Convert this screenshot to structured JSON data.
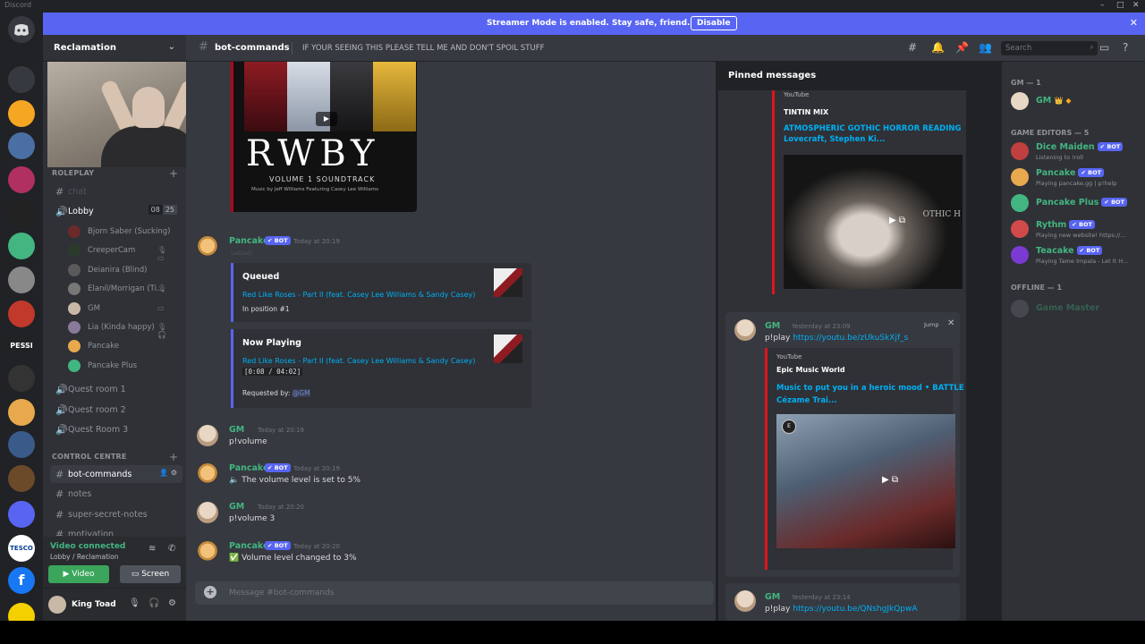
{
  "window": {
    "title": "Discord",
    "controls": [
      "–",
      "□",
      "✕"
    ]
  },
  "banner": {
    "text": "Streamer Mode is enabled. Stay safe, friend.",
    "button": "Disable",
    "close": "✕"
  },
  "guild": {
    "name": "Reclamation",
    "chevron": "⌄"
  },
  "sidebar": {
    "cat_roleplay": "ROLEPLAY",
    "plus": "+",
    "hidden_channel": "chat",
    "lobby": {
      "label": "Lobby",
      "count_a": "08",
      "count_b": "25"
    },
    "voice_users": [
      {
        "name": "Bjorn Saber (Sucking)",
        "color": "#6b2a2a",
        "icons": ""
      },
      {
        "name": "CreeperCam",
        "color": "#2b3a2b",
        "icons": "🎙 ▭"
      },
      {
        "name": "Deianira (Blind)",
        "color": "#5a5a5a",
        "icons": ""
      },
      {
        "name": "Elanil/Morrigan (Ti...",
        "color": "#777",
        "icons": "🎙"
      },
      {
        "name": "GM",
        "color": "#c8b8a6",
        "icons": "▭"
      },
      {
        "name": "Lia (Kinda happy)",
        "color": "#8a7a9a",
        "icons": "🎙 🎧"
      },
      {
        "name": "Pancake",
        "color": "#e8a94e",
        "icons": ""
      },
      {
        "name": "Pancake Plus",
        "color": "#43b581",
        "icons": ""
      }
    ],
    "quest_channels": [
      "Quest room 1",
      "Quest room 2",
      "Quest Room 3"
    ],
    "cat_control": "CONTROL CENTRE",
    "text_channels": [
      "bot-commands",
      "notes",
      "super-secret-notes",
      "motivation"
    ],
    "voice": {
      "status": "Video connected",
      "location": "Lobby / Reclamation",
      "video_btn": "Video",
      "screen_btn": "Screen"
    },
    "user": {
      "name": "King Toad"
    }
  },
  "header": {
    "channel": "bot-commands",
    "topic": "IF YOUR SEEING THIS PLEASE TELL ME AND DON'T SPOIL STUFF",
    "search_placeholder": "Search"
  },
  "rwby": {
    "logo": "RWBY",
    "subtitle": "VOLUME 1 SOUNDTRACK",
    "credits": "Music by Jeff Williams  Featuring Casey Lee Williams"
  },
  "chat": {
    "messages": [
      {
        "author": "Pancake",
        "bot": "✔ BOT",
        "time": "Today at 20:19"
      },
      {
        "author": "GM",
        "time": "Today at 20:19",
        "text": "p!volume"
      },
      {
        "author": "Pancake",
        "bot": "✔ BOT",
        "time": "Today at 20:19",
        "text": "🔈 The volume level is set to 5%"
      },
      {
        "author": "GM",
        "time": "Today at 20:20",
        "text": "p!volume 3"
      },
      {
        "author": "Pancake",
        "bot": "✔ BOT",
        "time": "Today at 20:20",
        "text": "✅ Volume level changed to 3%"
      }
    ],
    "edited": "(edited)",
    "queued": {
      "title": "Queued",
      "song": "Red Like Roses - Part II (feat. Casey Lee Williams & Sandy Casey)",
      "pos": "In position #1"
    },
    "nowplaying": {
      "title": "Now Playing",
      "song": "Red Like Roses - Part II (feat. Casey Lee Williams & Sandy Casey)",
      "time": "[0:08 / 04:02]",
      "req_label": "Requested by:",
      "req_user": "@GM"
    },
    "composer_placeholder": "Message #bot-commands"
  },
  "pinned": {
    "title": "Pinned messages",
    "card1": {
      "provider": "YouTube",
      "channel": "TINTIN MIX",
      "video_title_1": "ATMOSPHERIC GOTHIC HORROR READING",
      "video_title_2": "Lovecraft, Stephen Ki...",
      "overlay": "OTHIC H"
    },
    "card2": {
      "author": "GM",
      "time": "Yesterday at 23:09",
      "text": "p!play ",
      "link": "https://youtu.be/zUkuSkXjf_s",
      "jump": "Jump",
      "provider": "YouTube",
      "channel": "Epic Music World",
      "video_title_1": "Music to put you in a heroic mood • BATTLE",
      "video_title_2": "Cézame Trai..."
    },
    "card3": {
      "author": "GM",
      "time": "Yesterday at 23:14",
      "text": "p!play ",
      "link": "https://youtu.be/QNshgJkQpwA"
    }
  },
  "members": {
    "cat_gm": "GM — 1",
    "gm": {
      "name": "GM",
      "badges": "👑 ◆",
      "color": "#43b581"
    },
    "cat_editors": "GAME EDITORS — 5",
    "editors": [
      {
        "name": "Dice Maiden",
        "bot": "✔ BOT",
        "status": "Listening to !roll",
        "av": "#c04040"
      },
      {
        "name": "Pancake",
        "bot": "✔ BOT",
        "status": "Playing pancake.gg | p!help",
        "av": "#e8a94e"
      },
      {
        "name": "Pancake Plus",
        "bot": "✔ BOT",
        "status": "",
        "av": "#43b581"
      },
      {
        "name": "Rythm",
        "bot": "✔ BOT",
        "status": "Playing new website! https://...",
        "av": "#d14a4a"
      },
      {
        "name": "Teacake",
        "bot": "✔ BOT",
        "status": "Playing Tame Impala - Let It H...",
        "av": "#7b3ad1"
      }
    ],
    "cat_offline": "OFFLINE — 1",
    "offline": {
      "name": "Game Master"
    }
  },
  "servers": [
    {
      "label": "",
      "color": "#36393f"
    },
    {
      "label": "",
      "color": "#f5a623"
    },
    {
      "label": "",
      "color": "#4a6fa5"
    },
    {
      "label": "",
      "color": "#b03060"
    },
    {
      "label": "",
      "color": "#222"
    },
    {
      "label": "",
      "color": "#43b581"
    },
    {
      "label": "",
      "color": "#888"
    },
    {
      "label": "",
      "color": "#c0392b"
    },
    {
      "label": "PESSI TV",
      "color": "#202225"
    },
    {
      "label": "",
      "color": "#333"
    },
    {
      "label": "",
      "color": "#e8a94e"
    },
    {
      "label": "",
      "color": "#3a5a8a"
    },
    {
      "label": "",
      "color": "#6b4a2a"
    },
    {
      "label": "",
      "color": "#5865f2"
    },
    {
      "label": "TESCO",
      "color": "#ffffff"
    },
    {
      "label": "f",
      "color": "#1877f2"
    },
    {
      "label": "",
      "color": "#f5d000"
    },
    {
      "label": "",
      "color": "#c0392b"
    }
  ]
}
